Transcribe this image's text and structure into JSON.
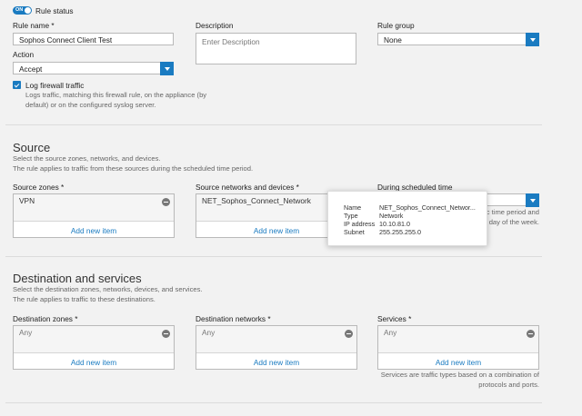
{
  "rule_status": {
    "toggle_label": "ON",
    "label": "Rule status"
  },
  "rule_name": {
    "label": "Rule name *",
    "value": "Sophos Connect Client Test"
  },
  "description": {
    "label": "Description",
    "placeholder": "Enter Description"
  },
  "rule_group": {
    "label": "Rule group",
    "value": "None"
  },
  "action": {
    "label": "Action",
    "value": "Accept"
  },
  "log": {
    "label": "Log firewall traffic",
    "help_line1": "Logs traffic, matching this firewall rule, on the appliance (by",
    "help_line2": "default) or on the configured syslog server."
  },
  "source": {
    "title": "Source",
    "desc1": "Select the source zones, networks, and devices.",
    "desc2": "The rule applies to traffic from these sources during the scheduled time period.",
    "zones": {
      "label": "Source zones *",
      "item": "VPN",
      "add": "Add new item"
    },
    "networks": {
      "label": "Source networks and devices *",
      "item": "NET_Sophos_Connect_Network",
      "add": "Add new item"
    },
    "schedule": {
      "label": "During scheduled time",
      "help1": "fic time period and",
      "help2": "day of the week."
    }
  },
  "tooltip": {
    "rows": [
      {
        "key": "Name",
        "value": "NET_Sophos_Connect_Networ..."
      },
      {
        "key": "Type",
        "value": "Network"
      },
      {
        "key": "IP address",
        "value": "10.10.81.0"
      },
      {
        "key": "Subnet",
        "value": "255.255.255.0"
      }
    ]
  },
  "destination": {
    "title": "Destination and services",
    "desc1": "Select the destination zones, networks, devices, and services.",
    "desc2": "The rule applies to traffic to these destinations.",
    "zones": {
      "label": "Destination zones *",
      "item": "Any",
      "add": "Add new item"
    },
    "networks": {
      "label": "Destination networks *",
      "item": "Any",
      "add": "Add new item"
    },
    "services": {
      "label": "Services *",
      "item": "Any",
      "add": "Add new item",
      "help1": "Services are traffic types based on a combination of",
      "help2": "protocols and ports."
    }
  },
  "colors": {
    "accent": "#1a7bc1",
    "background": "#f2f2f2"
  }
}
